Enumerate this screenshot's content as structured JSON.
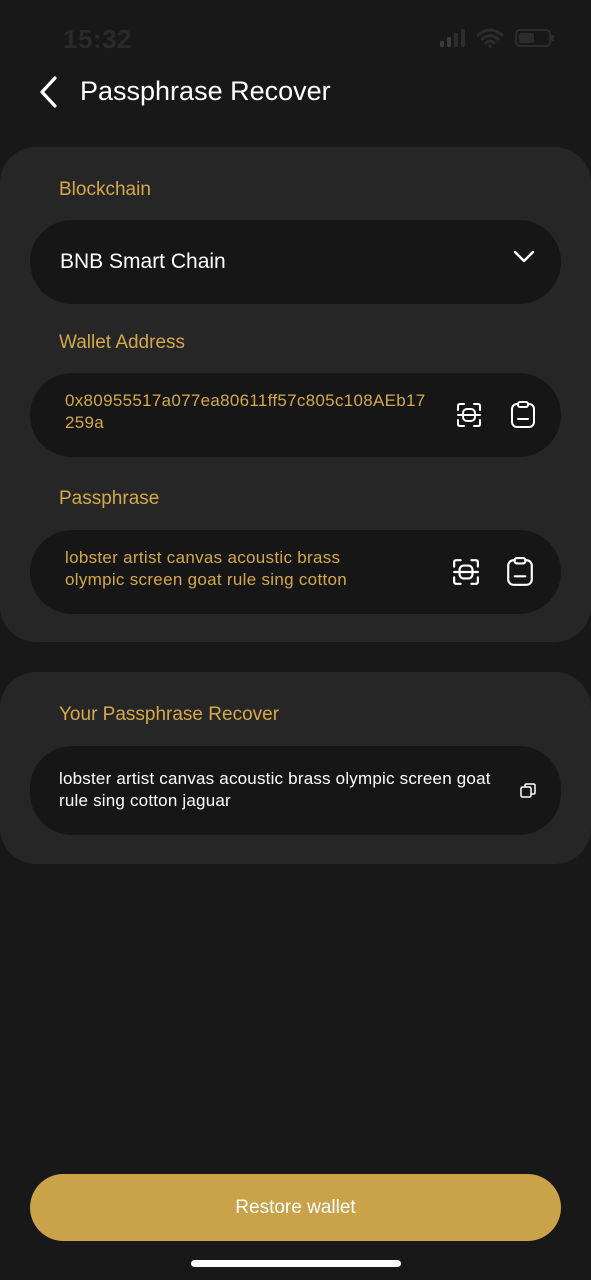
{
  "status": {
    "time": "15:32"
  },
  "header": {
    "title": "Passphrase Recover"
  },
  "form": {
    "blockchain_label": "Blockchain",
    "blockchain_value": "BNB Smart Chain",
    "wallet_label": "Wallet Address",
    "wallet_value": "0x80955517a077ea80611ff57c805c108AEb17259a",
    "passphrase_label": "Passphrase",
    "passphrase_value": "lobster artist canvas acoustic brass olympic screen goat rule sing cotton"
  },
  "result": {
    "label": "Your Passphrase Recover",
    "value": "lobster artist canvas acoustic brass olympic screen goat rule sing cotton jaguar"
  },
  "actions": {
    "restore_label": "Restore wallet"
  },
  "colors": {
    "accent": "#c9a24a",
    "label": "#d4a84a",
    "background": "#181818",
    "card": "#262626",
    "field": "#161616"
  },
  "icons": [
    "chevron-left-icon",
    "chevron-down-icon",
    "scan-icon",
    "paste-icon",
    "copy-icon",
    "signal-icon",
    "wifi-icon",
    "battery-icon"
  ]
}
